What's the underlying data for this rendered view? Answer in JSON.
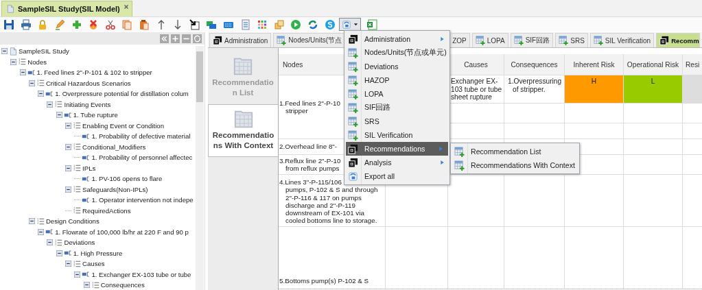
{
  "document_tab": {
    "title": "SampleSIL Study(SIL Model)",
    "selected": true
  },
  "tree": {
    "items": [
      {
        "label": "SampleSIL Study",
        "kind": "document",
        "expanded": true,
        "children": [
          {
            "label": "Nodes",
            "kind": "list",
            "expanded": true,
            "children": [
              {
                "label": "1. Feed lines 2\"-P-101 & 102 to stripper",
                "kind": "item",
                "expanded": true,
                "children": [
                  {
                    "label": "Critical Hazardous Scenarios",
                    "kind": "list",
                    "expanded": true,
                    "children": [
                      {
                        "label": "1. Overpressure potential for distillation colum",
                        "kind": "item",
                        "expanded": true,
                        "children": [
                          {
                            "label": "Initiating Events",
                            "kind": "list",
                            "expanded": true,
                            "children": [
                              {
                                "label": "1. Tube rupture",
                                "kind": "item",
                                "expanded": true,
                                "children": [
                                  {
                                    "label": "Enabling Event or Condition",
                                    "kind": "list",
                                    "expanded": true,
                                    "children": [
                                      {
                                        "label": "1. Probability of defective material",
                                        "kind": "item"
                                      }
                                    ]
                                  },
                                  {
                                    "label": "Conditional_Modifiers",
                                    "kind": "list",
                                    "expanded": true,
                                    "children": [
                                      {
                                        "label": "1. Probability of personnel affectec",
                                        "kind": "item"
                                      }
                                    ]
                                  },
                                  {
                                    "label": "IPLs",
                                    "kind": "list",
                                    "expanded": true,
                                    "children": [
                                      {
                                        "label": "1. PV-106 opens to flare",
                                        "kind": "item"
                                      }
                                    ]
                                  },
                                  {
                                    "label": "Safeguards(Non-IPLs)",
                                    "kind": "list",
                                    "expanded": true,
                                    "children": [
                                      {
                                        "label": "1. Operator intervention not indepe",
                                        "kind": "item"
                                      }
                                    ]
                                  },
                                  {
                                    "label": "RequiredActions",
                                    "kind": "list"
                                  }
                                ]
                              }
                            ]
                          }
                        ]
                      }
                    ]
                  },
                  {
                    "label": "Design Conditions",
                    "kind": "list",
                    "expanded": true,
                    "children": [
                      {
                        "label": "1. Flowrate of 100,000 lb/hr at 220 F and 90 p",
                        "kind": "item",
                        "expanded": true,
                        "children": [
                          {
                            "label": "Deviations",
                            "kind": "list",
                            "expanded": true,
                            "children": [
                              {
                                "label": "1. High Pressure",
                                "kind": "item",
                                "expanded": true,
                                "children": [
                                  {
                                    "label": "Causes",
                                    "kind": "list",
                                    "expanded": true,
                                    "children": [
                                      {
                                        "label": "1. Exchanger EX-103 tube or tube",
                                        "kind": "item",
                                        "expanded": true,
                                        "children": [
                                          {
                                            "label": "Consequences",
                                            "kind": "list",
                                            "expanded": true
                                          }
                                        ]
                                      }
                                    ]
                                  }
                                ]
                              }
                            ]
                          }
                        ]
                      }
                    ]
                  }
                ]
              }
            ]
          }
        ]
      }
    ]
  },
  "tabs": [
    {
      "label": "Administration",
      "kind": "module",
      "selected": false
    },
    {
      "label": "Nodes/Units(节点",
      "kind": "grid",
      "selected": false
    },
    {
      "label": "ZOP",
      "selected": false
    },
    {
      "label": "LOPA",
      "kind": "grid",
      "selected": false
    },
    {
      "label": "SIF回路",
      "kind": "grid",
      "selected": false
    },
    {
      "label": "SRS",
      "kind": "grid",
      "selected": false
    },
    {
      "label": "SIL Verification",
      "kind": "grid",
      "selected": false
    },
    {
      "label": "Recomm",
      "kind": "module",
      "selected": true
    }
  ],
  "side_views": [
    {
      "label": "Recommendation List",
      "selected": false
    },
    {
      "label": "Recommendations With Context",
      "selected": true
    }
  ],
  "table": {
    "columns": [
      "Nodes",
      "Causes",
      "Consequences",
      "Inherent Risk",
      "Operational Risk",
      "Resi"
    ],
    "nodes": [
      "1.Feed lines 2\"-P-10\nstripper",
      "2.Overhead line 8\"-",
      "3.Reflux line 2\"-P-10\nfrom reflux pumps",
      "4.Lines 3\"-P-115/106\npumps, P-102 & S and through\n2\"-P-116 & 117 on pumps\ndischarge and 2\"-P-119\ndownstream of EX-101 via\ncooled bottoms line to storage.",
      "5.Bottoms pump(s) P-102 & S"
    ],
    "rows": [
      {
        "cause": "Exchanger EX-103 tube or tube sheet rupture",
        "consequence": "1.Overpressuring of stripper.",
        "inherent_risk": {
          "text": "H",
          "color": "#ff9900"
        },
        "operational_risk": {
          "text": "L",
          "color": "#99cc00"
        }
      }
    ]
  },
  "menu": {
    "open": true,
    "items": [
      {
        "label": "Administration",
        "kind": "module",
        "submenu": true,
        "selected": false
      },
      {
        "label": "Nodes/Units(节点或单元)",
        "kind": "grid",
        "submenu": false,
        "selected": false
      },
      {
        "label": "Deviations",
        "kind": "grid",
        "submenu": false,
        "selected": false
      },
      {
        "label": "HAZOP",
        "kind": "grid",
        "submenu": false,
        "selected": false
      },
      {
        "label": "LOPA",
        "kind": "grid",
        "submenu": false,
        "selected": false
      },
      {
        "label": "SIF回路",
        "kind": "grid",
        "submenu": false,
        "selected": false
      },
      {
        "label": "SRS",
        "kind": "grid",
        "submenu": false,
        "selected": false
      },
      {
        "label": "SIL Verification",
        "kind": "grid",
        "submenu": false,
        "selected": false
      },
      {
        "label": "Recommendations",
        "kind": "module",
        "submenu": true,
        "selected": true
      },
      {
        "label": "Analysis",
        "kind": "module",
        "submenu": true,
        "selected": false
      },
      {
        "label": "Export all",
        "kind": "export",
        "submenu": false,
        "selected": false
      }
    ],
    "submenu": [
      {
        "label": "Recommendation List",
        "kind": "grid"
      },
      {
        "label": "Recommendations With Context",
        "kind": "grid"
      }
    ]
  }
}
